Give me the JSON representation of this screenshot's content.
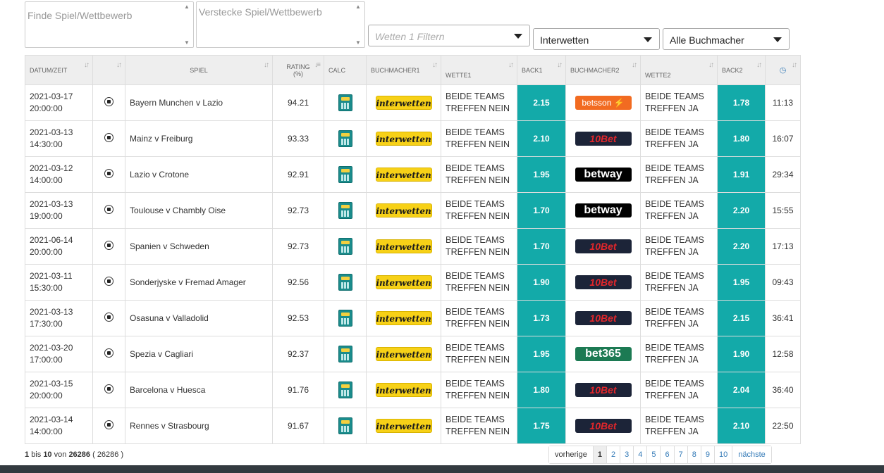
{
  "filters": {
    "find_placeholder": "Finde Spiel/Wettbewerb",
    "hide_placeholder": "Verstecke Spiel/Wettbewerb",
    "bet1_placeholder": "Wetten 1 Filtern",
    "bookmaker1_value": "Interwetten",
    "bookmaker2_value": "Alle Buchmacher"
  },
  "headers": {
    "datum": "DATUM/ZEIT",
    "spiel": "SPIEL",
    "rating": "RATING",
    "rating_unit": "(%)",
    "calc": "CALC",
    "bm1": "BUCHMACHER1",
    "wette1": "WETTE1",
    "back1": "BACK1",
    "bm2": "BUCHMACHER2",
    "wette2": "WETTE2",
    "back2": "BACK2",
    "sort_arrows": "↓↑",
    "sort_arrows_active": "↓≡"
  },
  "logos": {
    "interwetten": "interwetten",
    "betsson": "betsson ⚡",
    "10bet": "10Bet",
    "betway": "betway",
    "bet365": "bet365"
  },
  "rows": [
    {
      "date": "2021-03-17",
      "time": "20:00:00",
      "match": "Bayern Munchen v Lazio",
      "rating": "94.21",
      "bet1a": "BEIDE TEAMS",
      "bet1b": "TREFFEN NEIN",
      "back1": "2.15",
      "bm2": "betsson",
      "bet2a": "BEIDE TEAMS",
      "bet2b": "TREFFEN JA",
      "back2": "1.78",
      "age": "11:13"
    },
    {
      "date": "2021-03-13",
      "time": "14:30:00",
      "match": "Mainz v Freiburg",
      "rating": "93.33",
      "bet1a": "BEIDE TEAMS",
      "bet1b": "TREFFEN NEIN",
      "back1": "2.10",
      "bm2": "10bet",
      "bet2a": "BEIDE TEAMS",
      "bet2b": "TREFFEN JA",
      "back2": "1.80",
      "age": "16:07"
    },
    {
      "date": "2021-03-12",
      "time": "14:00:00",
      "match": "Lazio v Crotone",
      "rating": "92.91",
      "bet1a": "BEIDE TEAMS",
      "bet1b": "TREFFEN NEIN",
      "back1": "1.95",
      "bm2": "betway",
      "bet2a": "BEIDE TEAMS",
      "bet2b": "TREFFEN JA",
      "back2": "1.91",
      "age": "29:34"
    },
    {
      "date": "2021-03-13",
      "time": "19:00:00",
      "match": "Toulouse v Chambly Oise",
      "rating": "92.73",
      "bet1a": "BEIDE TEAMS",
      "bet1b": "TREFFEN NEIN",
      "back1": "1.70",
      "bm2": "betway",
      "bet2a": "BEIDE TEAMS",
      "bet2b": "TREFFEN JA",
      "back2": "2.20",
      "age": "15:55"
    },
    {
      "date": "2021-06-14",
      "time": "20:00:00",
      "match": "Spanien v Schweden",
      "rating": "92.73",
      "bet1a": "BEIDE TEAMS",
      "bet1b": "TREFFEN NEIN",
      "back1": "1.70",
      "bm2": "10bet",
      "bet2a": "BEIDE TEAMS",
      "bet2b": "TREFFEN JA",
      "back2": "2.20",
      "age": "17:13"
    },
    {
      "date": "2021-03-11",
      "time": "15:30:00",
      "match": "Sonderjyske v Fremad Amager",
      "rating": "92.56",
      "bet1a": "BEIDE TEAMS",
      "bet1b": "TREFFEN NEIN",
      "back1": "1.90",
      "bm2": "10bet",
      "bet2a": "BEIDE TEAMS",
      "bet2b": "TREFFEN JA",
      "back2": "1.95",
      "age": "09:43"
    },
    {
      "date": "2021-03-13",
      "time": "17:30:00",
      "match": "Osasuna v Valladolid",
      "rating": "92.53",
      "bet1a": "BEIDE TEAMS",
      "bet1b": "TREFFEN NEIN",
      "back1": "1.73",
      "bm2": "10bet",
      "bet2a": "BEIDE TEAMS",
      "bet2b": "TREFFEN JA",
      "back2": "2.15",
      "age": "36:41"
    },
    {
      "date": "2021-03-20",
      "time": "17:00:00",
      "match": "Spezia v Cagliari",
      "rating": "92.37",
      "bet1a": "BEIDE TEAMS",
      "bet1b": "TREFFEN NEIN",
      "back1": "1.95",
      "bm2": "bet365",
      "bet2a": "BEIDE TEAMS",
      "bet2b": "TREFFEN JA",
      "back2": "1.90",
      "age": "12:58"
    },
    {
      "date": "2021-03-15",
      "time": "20:00:00",
      "match": "Barcelona v Huesca",
      "rating": "91.76",
      "bet1a": "BEIDE TEAMS",
      "bet1b": "TREFFEN NEIN",
      "back1": "1.80",
      "bm2": "10bet",
      "bet2a": "BEIDE TEAMS",
      "bet2b": "TREFFEN JA",
      "back2": "2.04",
      "age": "36:40"
    },
    {
      "date": "2021-03-14",
      "time": "14:00:00",
      "match": "Rennes v Strasbourg",
      "rating": "91.67",
      "bet1a": "BEIDE TEAMS",
      "bet1b": "TREFFEN NEIN",
      "back1": "1.75",
      "bm2": "10bet",
      "bet2a": "BEIDE TEAMS",
      "bet2b": "TREFFEN JA",
      "back2": "2.10",
      "age": "22:50"
    }
  ],
  "footer": {
    "from": "1",
    "bis": "bis",
    "to": "10",
    "von": "von",
    "total": "26286",
    "total_paren": "( 26286 )"
  },
  "pager": {
    "prev": "vorherige",
    "pages": [
      "1",
      "2",
      "3",
      "4",
      "5",
      "6",
      "7",
      "8",
      "9",
      "10"
    ],
    "next": "nächste",
    "active": "1"
  },
  "colors": {
    "odds_bg": "#13aaa9",
    "header_bg": "#eeeeee"
  }
}
